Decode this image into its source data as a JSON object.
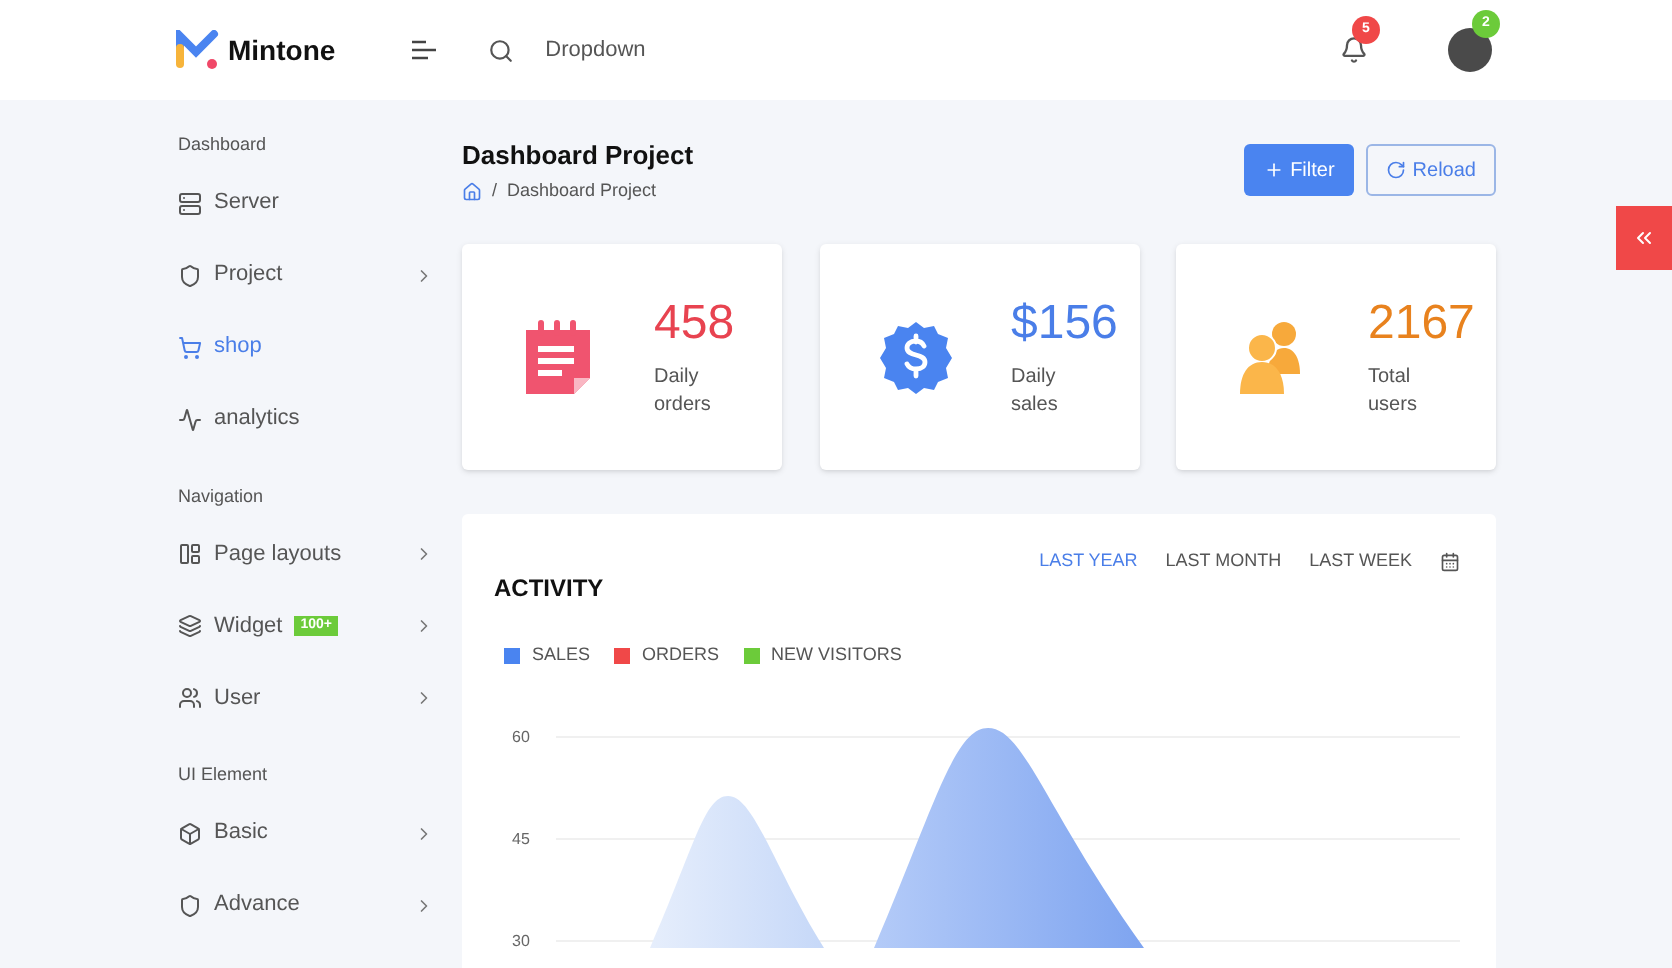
{
  "header": {
    "brand": "Mintone",
    "search_label": "Dropdown",
    "notifications_count": "5",
    "profile_count": "2"
  },
  "sidebar": {
    "sections": [
      {
        "title": "Dashboard",
        "items": [
          {
            "label": "Server",
            "selected": false,
            "has_children": false
          },
          {
            "label": "Project",
            "selected": false,
            "has_children": true
          },
          {
            "label": "shop",
            "selected": true,
            "has_children": false
          },
          {
            "label": "analytics",
            "selected": false,
            "has_children": false
          }
        ]
      },
      {
        "title": "Navigation",
        "items": [
          {
            "label": "Page layouts",
            "selected": false,
            "has_children": true
          },
          {
            "label": "Widget",
            "selected": false,
            "has_children": true,
            "badge": "100+"
          },
          {
            "label": "User",
            "selected": false,
            "has_children": true
          }
        ]
      },
      {
        "title": "UI Element",
        "items": [
          {
            "label": "Basic",
            "selected": false,
            "has_children": true
          },
          {
            "label": "Advance",
            "selected": false,
            "has_children": true
          }
        ]
      }
    ]
  },
  "page": {
    "title": "Dashboard Project",
    "breadcrumb_separator": "/",
    "breadcrumb": "Dashboard Project",
    "buttons": [
      {
        "label": "Filter",
        "kind": "primary"
      },
      {
        "label": "Reload",
        "kind": "outline"
      }
    ]
  },
  "stats": [
    {
      "value": "458",
      "label": "Daily orders",
      "kind": "orders",
      "color": "#e84350"
    },
    {
      "value": "$156",
      "label": "Daily sales",
      "kind": "sales",
      "color": "#4a7ee8"
    },
    {
      "value": "2167",
      "label": "Total users",
      "kind": "users",
      "color": "#e8821e"
    }
  ],
  "activity": {
    "title": "ACTIVITY",
    "ranges": [
      {
        "label": "LAST YEAR",
        "selected": true
      },
      {
        "label": "LAST MONTH",
        "selected": false
      },
      {
        "label": "LAST WEEK",
        "selected": false
      }
    ],
    "legend": [
      {
        "label": "SALES",
        "color": "#4a84f0"
      },
      {
        "label": "ORDERS",
        "color": "#f04848"
      },
      {
        "label": "NEW VISITORS",
        "color": "#6ccb3a"
      }
    ],
    "y_labels": [
      "60",
      "45",
      "30"
    ]
  }
}
